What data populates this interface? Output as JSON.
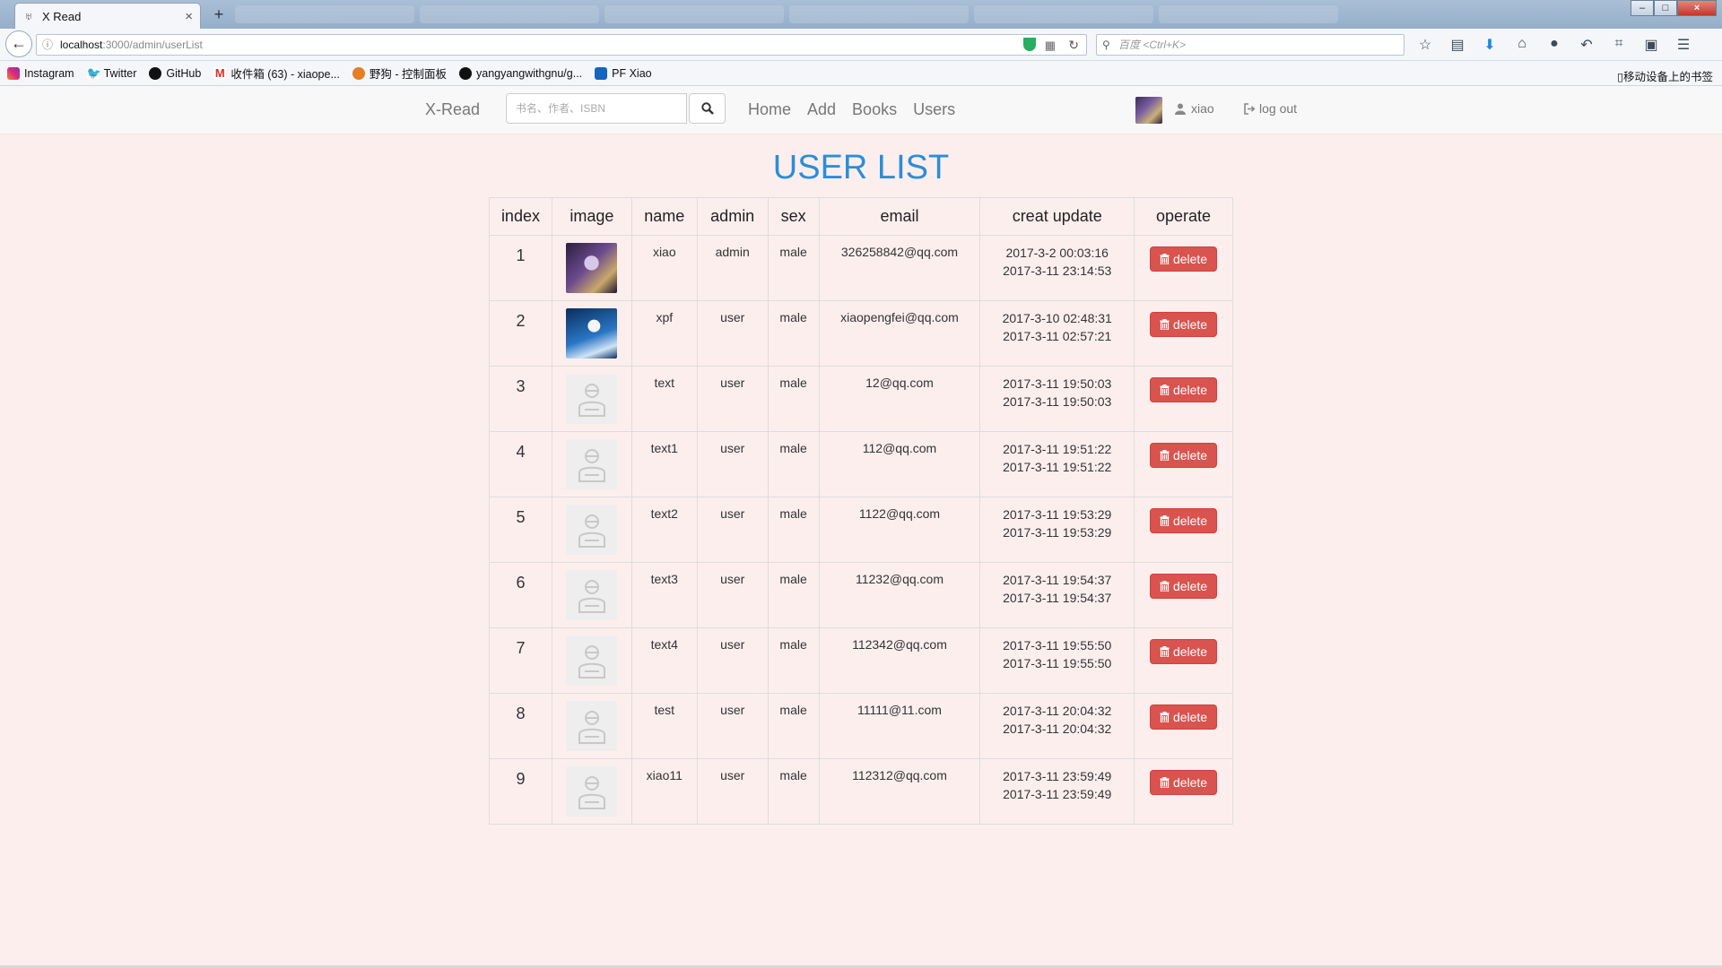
{
  "browser": {
    "tab_title": "X Read",
    "url_host": "localhost",
    "url_path": ":3000/admin/userList",
    "search_placeholder": "百度 <Ctrl+K>",
    "bookmarks": [
      "Instagram",
      "Twitter",
      "GitHub",
      "收件箱 (63) - xiaope...",
      "野狗 - 控制面板",
      "yangyangwithgnu/g...",
      "PF Xiao"
    ],
    "bookmarks_right": "移动设备上的书签"
  },
  "nav": {
    "brand": "X-Read",
    "search_placeholder": "书名、作者、ISBN",
    "links": [
      "Home",
      "Add",
      "Books",
      "Users"
    ],
    "username": "xiao",
    "logout": "log out"
  },
  "page_title": "USER LIST",
  "table": {
    "headers": [
      "index",
      "image",
      "name",
      "admin",
      "sex",
      "email",
      "creat update",
      "operate"
    ],
    "delete_label": "delete",
    "rows": [
      {
        "index": "1",
        "image": "avatar-custom-1",
        "name": "xiao",
        "admin": "admin",
        "sex": "male",
        "email": "326258842@qq.com",
        "created": "2017-3-2 00:03:16",
        "updated": "2017-3-11 23:14:53"
      },
      {
        "index": "2",
        "image": "avatar-custom-2",
        "name": "xpf",
        "admin": "user",
        "sex": "male",
        "email": "xiaopengfei@qq.com",
        "created": "2017-3-10 02:48:31",
        "updated": "2017-3-11 02:57:21"
      },
      {
        "index": "3",
        "image": "avatar-default",
        "name": "text",
        "admin": "user",
        "sex": "male",
        "email": "12@qq.com",
        "created": "2017-3-11 19:50:03",
        "updated": "2017-3-11 19:50:03"
      },
      {
        "index": "4",
        "image": "avatar-default",
        "name": "text1",
        "admin": "user",
        "sex": "male",
        "email": "112@qq.com",
        "created": "2017-3-11 19:51:22",
        "updated": "2017-3-11 19:51:22"
      },
      {
        "index": "5",
        "image": "avatar-default",
        "name": "text2",
        "admin": "user",
        "sex": "male",
        "email": "1122@qq.com",
        "created": "2017-3-11 19:53:29",
        "updated": "2017-3-11 19:53:29"
      },
      {
        "index": "6",
        "image": "avatar-default",
        "name": "text3",
        "admin": "user",
        "sex": "male",
        "email": "11232@qq.com",
        "created": "2017-3-11 19:54:37",
        "updated": "2017-3-11 19:54:37"
      },
      {
        "index": "7",
        "image": "avatar-default",
        "name": "text4",
        "admin": "user",
        "sex": "male",
        "email": "112342@qq.com",
        "created": "2017-3-11 19:55:50",
        "updated": "2017-3-11 19:55:50"
      },
      {
        "index": "8",
        "image": "avatar-default",
        "name": "test",
        "admin": "user",
        "sex": "male",
        "email": "11111@11.com",
        "created": "2017-3-11 20:04:32",
        "updated": "2017-3-11 20:04:32"
      },
      {
        "index": "9",
        "image": "avatar-default",
        "name": "xiao11",
        "admin": "user",
        "sex": "male",
        "email": "112312@qq.com",
        "created": "2017-3-11 23:59:49",
        "updated": "2017-3-11 23:59:49"
      }
    ]
  },
  "colors": {
    "page_bg": "#fdeeee",
    "title": "#2a8ed8",
    "danger": "#d9534f"
  }
}
